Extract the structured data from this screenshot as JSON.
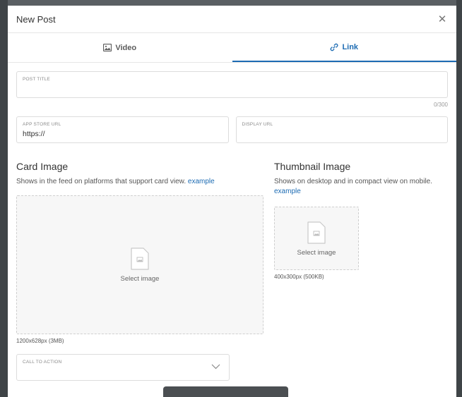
{
  "modal": {
    "title": "New Post",
    "close_icon": "close-icon"
  },
  "tabs": [
    {
      "label": "Video",
      "icon": "image-icon",
      "active": false
    },
    {
      "label": "Link",
      "icon": "link-icon",
      "active": true
    }
  ],
  "post_title": {
    "label": "POST TITLE",
    "value": "",
    "counter": "0/300"
  },
  "app_store_url": {
    "label": "APP STORE URL",
    "value": "https://"
  },
  "display_url": {
    "label": "DISPLAY URL",
    "value": ""
  },
  "card_image": {
    "title": "Card Image",
    "description": "Shows in the feed on platforms that support card view.",
    "example_link": "example",
    "select_label": "Select image",
    "size_note": "1200x628px (3MB)"
  },
  "thumbnail_image": {
    "title": "Thumbnail Image",
    "description": "Shows on desktop and in compact view on mobile.",
    "example_link": "example",
    "select_label": "Select image",
    "size_note": "400x300px (500KB)"
  },
  "call_to_action": {
    "label": "CALL TO ACTION",
    "value": ""
  },
  "colors": {
    "accent": "#1c6bb3",
    "border": "#dcdcdc",
    "dropzone_bg": "#f7f7f7"
  }
}
